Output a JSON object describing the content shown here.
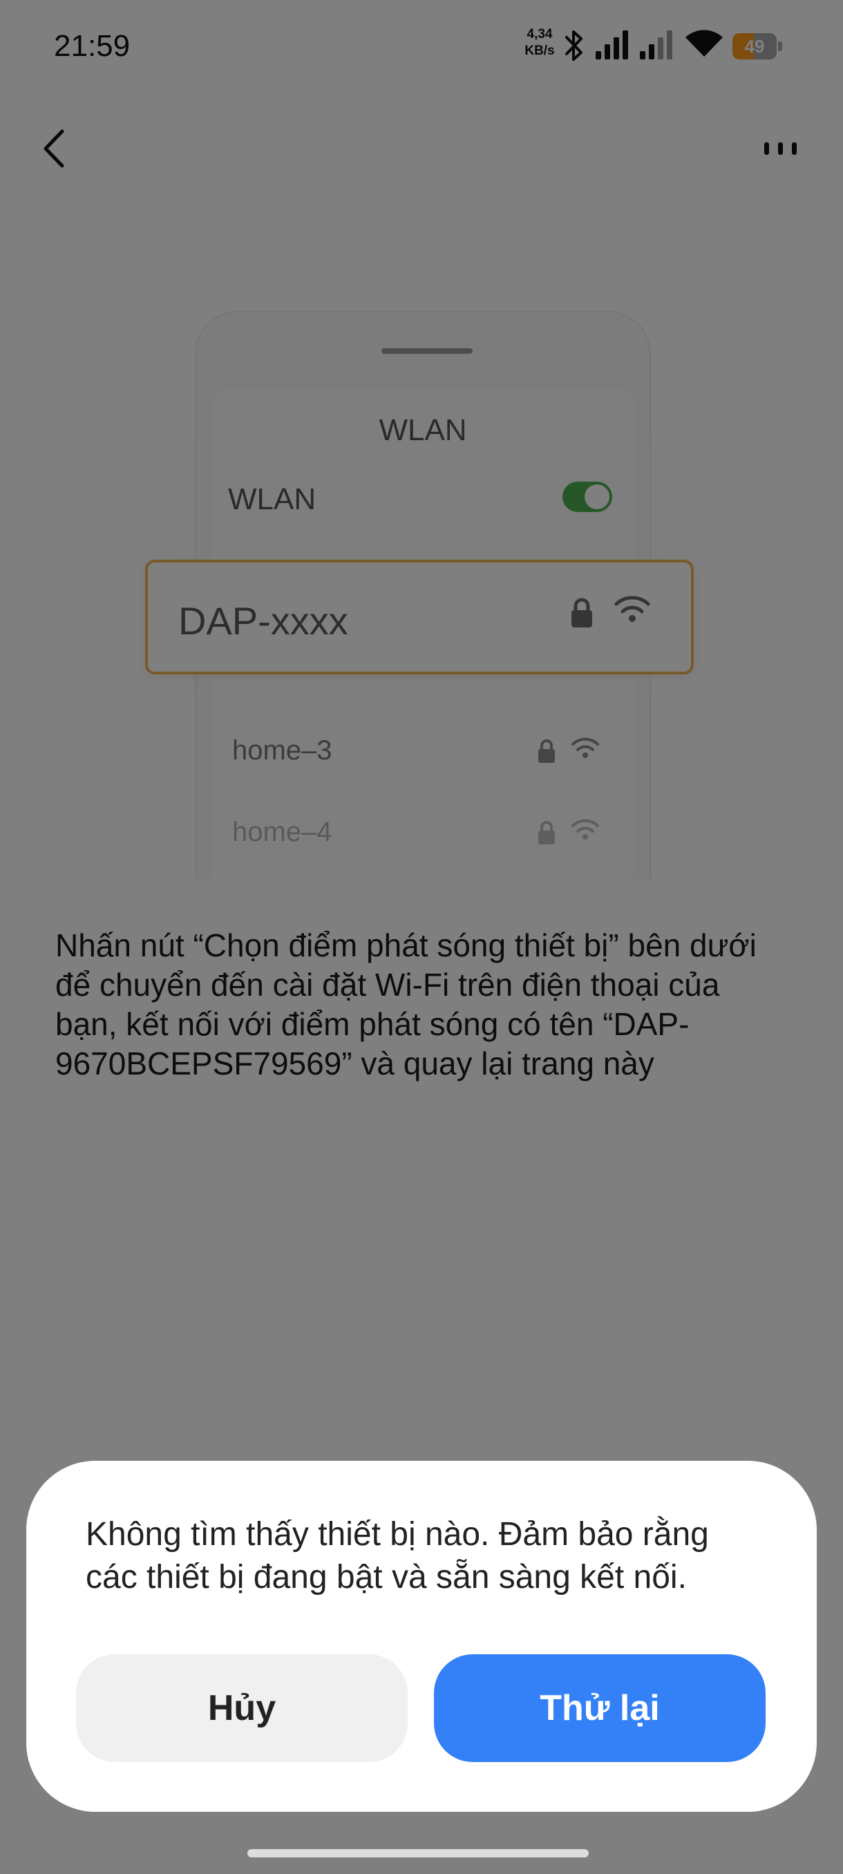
{
  "status_bar": {
    "time": "21:59",
    "net_speed_value": "4,34",
    "net_speed_unit": "KB/s",
    "battery_level": "49",
    "battery_fraction": 0.49,
    "battery_color": "#ff9b1a",
    "icons": [
      "bluetooth-icon",
      "signal-icon",
      "signal-icon",
      "wifi-icon",
      "battery-icon"
    ]
  },
  "nav": {
    "back_icon": "chevron-left-icon",
    "more_icon": "more-icon"
  },
  "illustration": {
    "screen_title": "WLAN",
    "toggle_label": "WLAN",
    "toggle_on": true,
    "toggle_color": "#4caf50",
    "highlighted_network": "DAP-xxxx",
    "highlight_color": "#f3b24e",
    "networks": [
      {
        "name": "home–3"
      },
      {
        "name": "home–4"
      }
    ]
  },
  "instruction": "Nhấn nút “Chọn điểm phát sóng thiết bị” bên dưới để chuyển đến cài đặt Wi-Fi trên điện thoại của bạn, kết nối với điểm phát sóng có tên “DAP-9670BCEPSF79569” và quay lại trang này",
  "dialog": {
    "message": "Không tìm thấy thiết bị nào. Đảm bảo rằng các thiết bị đang bật và sẵn sàng kết nối.",
    "cancel_label": "Hủy",
    "retry_label": "Thử lại",
    "retry_color": "#3481f7"
  }
}
